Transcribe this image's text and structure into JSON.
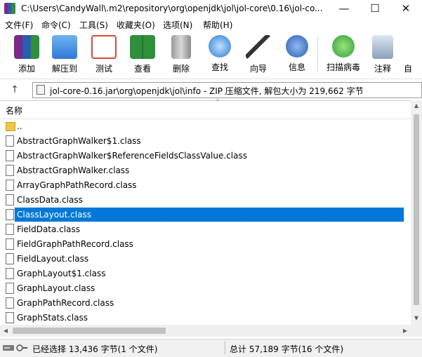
{
  "window": {
    "title": "C:\\Users\\CandyWall\\.m2\\repository\\org\\openjdk\\jol\\jol-core\\0.16\\jol-co...",
    "minimize": "—",
    "maximize": "☐",
    "close": "✕"
  },
  "menu": [
    "文件(F)",
    "命令(C)",
    "工具(S)",
    "收藏夹(O)",
    "选项(N)",
    "帮助(H)"
  ],
  "toolbar": {
    "buttons": [
      {
        "label": "添加",
        "icon": "archive-add-icon",
        "color": "#8a3a9a"
      },
      {
        "label": "解压到",
        "icon": "folder-extract-icon",
        "color": "#4a8fd8"
      },
      {
        "label": "测试",
        "icon": "checklist-icon",
        "color": "#d84a3a"
      },
      {
        "label": "查看",
        "icon": "book-view-icon",
        "color": "#3a9a4a"
      },
      {
        "label": "删除",
        "icon": "trash-icon",
        "color": "#8a8a8a"
      },
      {
        "label": "查找",
        "icon": "magnifier-icon",
        "color": "#2a7ad0"
      },
      {
        "label": "向导",
        "icon": "magic-wand-icon",
        "color": "#c0a020"
      },
      {
        "label": "信息",
        "icon": "info-icon",
        "color": "#2a5db0"
      },
      {
        "label": "扫描病毒",
        "icon": "virus-scan-icon",
        "color": "#2f9f3a"
      },
      {
        "label": "注释",
        "icon": "comment-icon",
        "color": "#5a7aa0"
      },
      {
        "label": "自",
        "icon": "more-icon",
        "color": "#ffffff"
      }
    ]
  },
  "address": {
    "up_label": "↑",
    "path": "jol-core-0.16.jar\\org\\openjdk\\jol\\info - ZIP 压缩文件, 解包大小为 219,662 字节"
  },
  "list": {
    "column_name": "名称",
    "sort_indicator": "^",
    "rows": [
      {
        "name": "..",
        "type": "folder"
      },
      {
        "name": "AbstractGraphWalker$1.class",
        "type": "file"
      },
      {
        "name": "AbstractGraphWalker$ReferenceFieldsClassValue.class",
        "type": "file"
      },
      {
        "name": "AbstractGraphWalker.class",
        "type": "file"
      },
      {
        "name": "ArrayGraphPathRecord.class",
        "type": "file"
      },
      {
        "name": "ClassData.class",
        "type": "file"
      },
      {
        "name": "ClassLayout.class",
        "type": "file",
        "selected": true
      },
      {
        "name": "FieldData.class",
        "type": "file"
      },
      {
        "name": "FieldGraphPathRecord.class",
        "type": "file"
      },
      {
        "name": "FieldLayout.class",
        "type": "file"
      },
      {
        "name": "GraphLayout$1.class",
        "type": "file"
      },
      {
        "name": "GraphLayout.class",
        "type": "file"
      },
      {
        "name": "GraphPathRecord.class",
        "type": "file"
      },
      {
        "name": "GraphStats.class",
        "type": "file"
      }
    ]
  },
  "scroll": {
    "up": "▲",
    "down": "▼",
    "left": "◀",
    "right": "▶"
  },
  "status": {
    "selected": "已经选择 13,436 字节(1 个文件)",
    "total": "总计 57,189 字节(16 个文件)"
  }
}
